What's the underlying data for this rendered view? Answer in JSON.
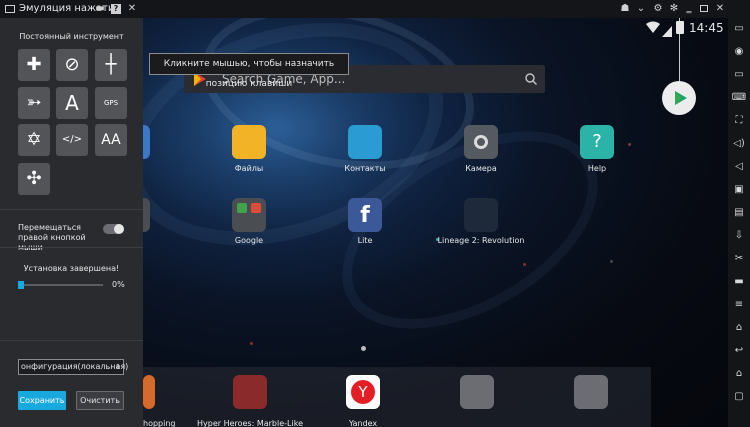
{
  "window": {
    "title": "Эмуляция нажатия",
    "icons": [
      "keyboard-icon",
      "folder-icon",
      "help-icon",
      "close-icon"
    ],
    "right_icons": [
      "gamepad-icon",
      "chevron-down-icon",
      "settings-icon",
      "minimize-icon",
      "maximize-icon",
      "close-icon"
    ]
  },
  "statusbar": {
    "time": "14:45"
  },
  "search": {
    "placeholder": "Search Game, App..."
  },
  "tooltip": {
    "text": "Кликните мышью, чтобы назначить позицию клавиши"
  },
  "apps": [
    {
      "label": "Файлы",
      "color": "#f2b327"
    },
    {
      "label": "Контакты",
      "color": "#2b9bd3"
    },
    {
      "label": "Камера",
      "color": "#555a61"
    },
    {
      "label": "Help",
      "color": "#2bb3a8"
    },
    {
      "label": "Google",
      "color": "#4a4d52"
    },
    {
      "label": "Lite",
      "color": "#3b5998"
    },
    {
      "label": "Lineage 2: Revolution",
      "color": "#1e2a3a"
    }
  ],
  "dock": [
    {
      "label": "hopping"
    },
    {
      "label": "Hyper Heroes: Marble-Like RPG"
    },
    {
      "label": "Yandex"
    },
    {
      "label": ""
    },
    {
      "label": ""
    }
  ],
  "panel": {
    "section_title": "Постоянный инструмент",
    "tools": [
      {
        "name": "dpad-tool-icon",
        "glyph": "✚"
      },
      {
        "name": "no-smartcast-tool-icon",
        "glyph": "⊘"
      },
      {
        "name": "crosshair-tool-icon",
        "glyph": "┼"
      },
      {
        "name": "gun-tool-icon",
        "glyph": "➳"
      },
      {
        "name": "text-tool-icon",
        "glyph": "A"
      },
      {
        "name": "gps-tool-icon",
        "glyph": "GPS"
      },
      {
        "name": "star-tool-icon",
        "glyph": "✡"
      },
      {
        "name": "script-tool-icon",
        "glyph": "</>"
      },
      {
        "name": "font-size-tool-icon",
        "glyph": "AA"
      },
      {
        "name": "gyro-tool-icon",
        "glyph": "✣"
      }
    ],
    "move_right_button_label": "Перемещаться правой кнопкой мыши",
    "install_status": "Установка завершена!",
    "progress": {
      "value": 0,
      "label": "0%"
    },
    "config_select": "онфигурация(локальная)",
    "save_label": "Сохранить",
    "clear_label": "Очистить"
  },
  "sidebar": {
    "icons": [
      "display-icon",
      "location-icon",
      "display-icon",
      "keyboard-icon",
      "fullscreen-icon",
      "volume-up-icon",
      "volume-down-icon",
      "camera-icon",
      "apk-icon",
      "install-icon",
      "scissors-icon",
      "folder-icon",
      "menu-icon",
      "home-icon",
      "back-icon",
      "home-icon",
      "recents-icon"
    ]
  },
  "colors": {
    "accent": "#18a9de",
    "panel_bg": "#2a2b2f",
    "title_bg": "#141519"
  }
}
